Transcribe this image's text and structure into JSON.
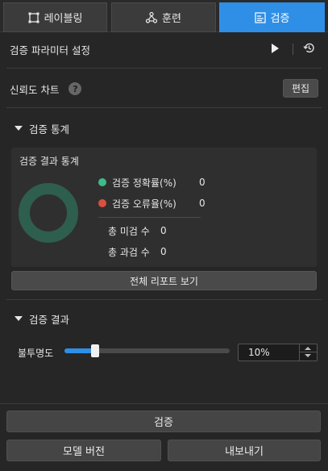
{
  "tabs": [
    {
      "label": "레이블링",
      "icon": "labeling-icon",
      "active": false
    },
    {
      "label": "훈련",
      "icon": "training-icon",
      "active": false
    },
    {
      "label": "검증",
      "icon": "validation-icon",
      "active": true
    }
  ],
  "params_header": {
    "title": "검증 파라미터 설정",
    "play_icon": "play-icon",
    "history_icon": "history-icon"
  },
  "confidence_chart": {
    "label": "신뢰도 차트",
    "help": "?",
    "edit_label": "편집"
  },
  "stats_section": {
    "title": "검증 통계",
    "box_title": "검증 결과 통계",
    "accuracy_label": "검증 정확률(%)",
    "accuracy_value": "0",
    "error_label": "검증 오류율(%)",
    "error_value": "0",
    "missed_label": "총 미검 수",
    "missed_value": "0",
    "over_label": "총 과검 수",
    "over_value": "0",
    "report_button": "전체 리포트 보기"
  },
  "results_section": {
    "title": "검증 결과",
    "opacity_label": "불투명도",
    "opacity_value": "10%",
    "opacity_fraction": 0.1
  },
  "footer": {
    "validate_button": "검증",
    "model_version_button": "모델 버전",
    "export_button": "내보내기"
  },
  "colors": {
    "accent": "#2f8fe6",
    "accuracy": "#3dbb8a",
    "error": "#d9503f",
    "donut": "#2e5e4e"
  }
}
